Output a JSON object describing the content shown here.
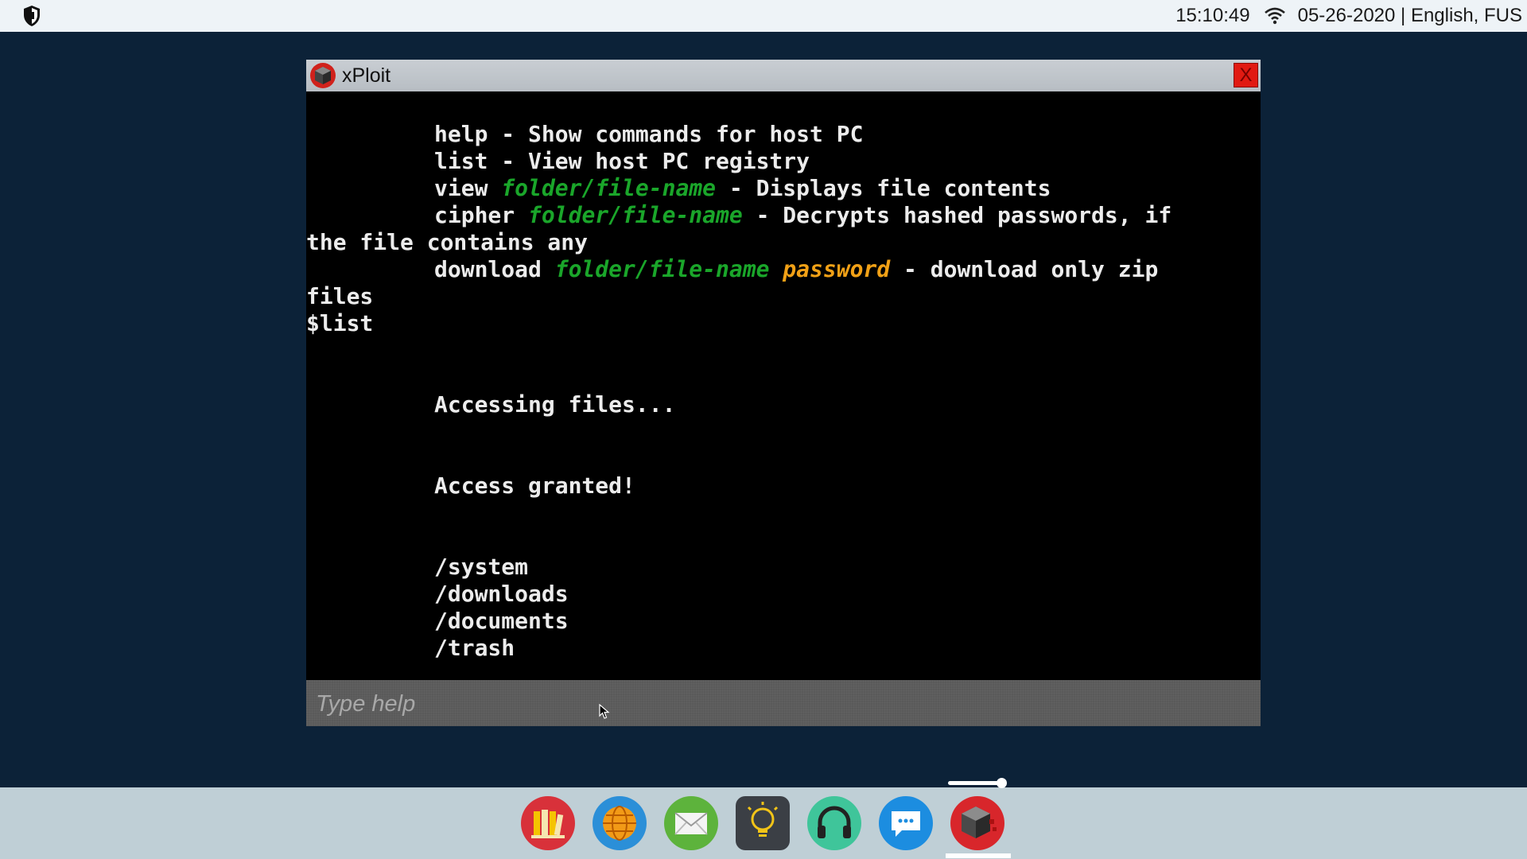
{
  "system": {
    "time": "15:10:49",
    "date_locale": "05-26-2020 | English, FUS"
  },
  "window": {
    "title": "xPloit",
    "close_label": "X"
  },
  "terminal": {
    "help_line": "help - Show commands for host PC",
    "list_line": "list - View host PC registry",
    "view": {
      "cmd": "view ",
      "arg": "folder/file-name",
      "desc": " - Displays file contents"
    },
    "cipher": {
      "cmd": "cipher ",
      "arg": "folder/file-name",
      "desc": " - Decrypts hashed passwords, if",
      "wrap": "the file contains any"
    },
    "download": {
      "cmd": "download ",
      "arg": "folder/file-name",
      "arg2": "password",
      "desc": " - download only zip",
      "wrap": "files"
    },
    "prompt_cmd": "$list",
    "accessing": "Accessing files...",
    "granted": "Access granted!",
    "folders": [
      "/system",
      "/downloads",
      "/documents",
      "/trash"
    ]
  },
  "command_input": {
    "placeholder": "Type help",
    "value": ""
  },
  "dock": {
    "items": [
      {
        "name": "library-icon"
      },
      {
        "name": "browser-icon"
      },
      {
        "name": "mail-icon"
      },
      {
        "name": "lightbulb-icon"
      },
      {
        "name": "headphones-icon"
      },
      {
        "name": "chat-icon"
      },
      {
        "name": "xploit-icon"
      }
    ],
    "active": "xPloit",
    "volume_fraction": 0.88
  },
  "colors": {
    "desktop": "#0c2238",
    "arg_green": "#1aa62a",
    "arg_orange": "#f2a116",
    "close_red": "#e11a12"
  }
}
